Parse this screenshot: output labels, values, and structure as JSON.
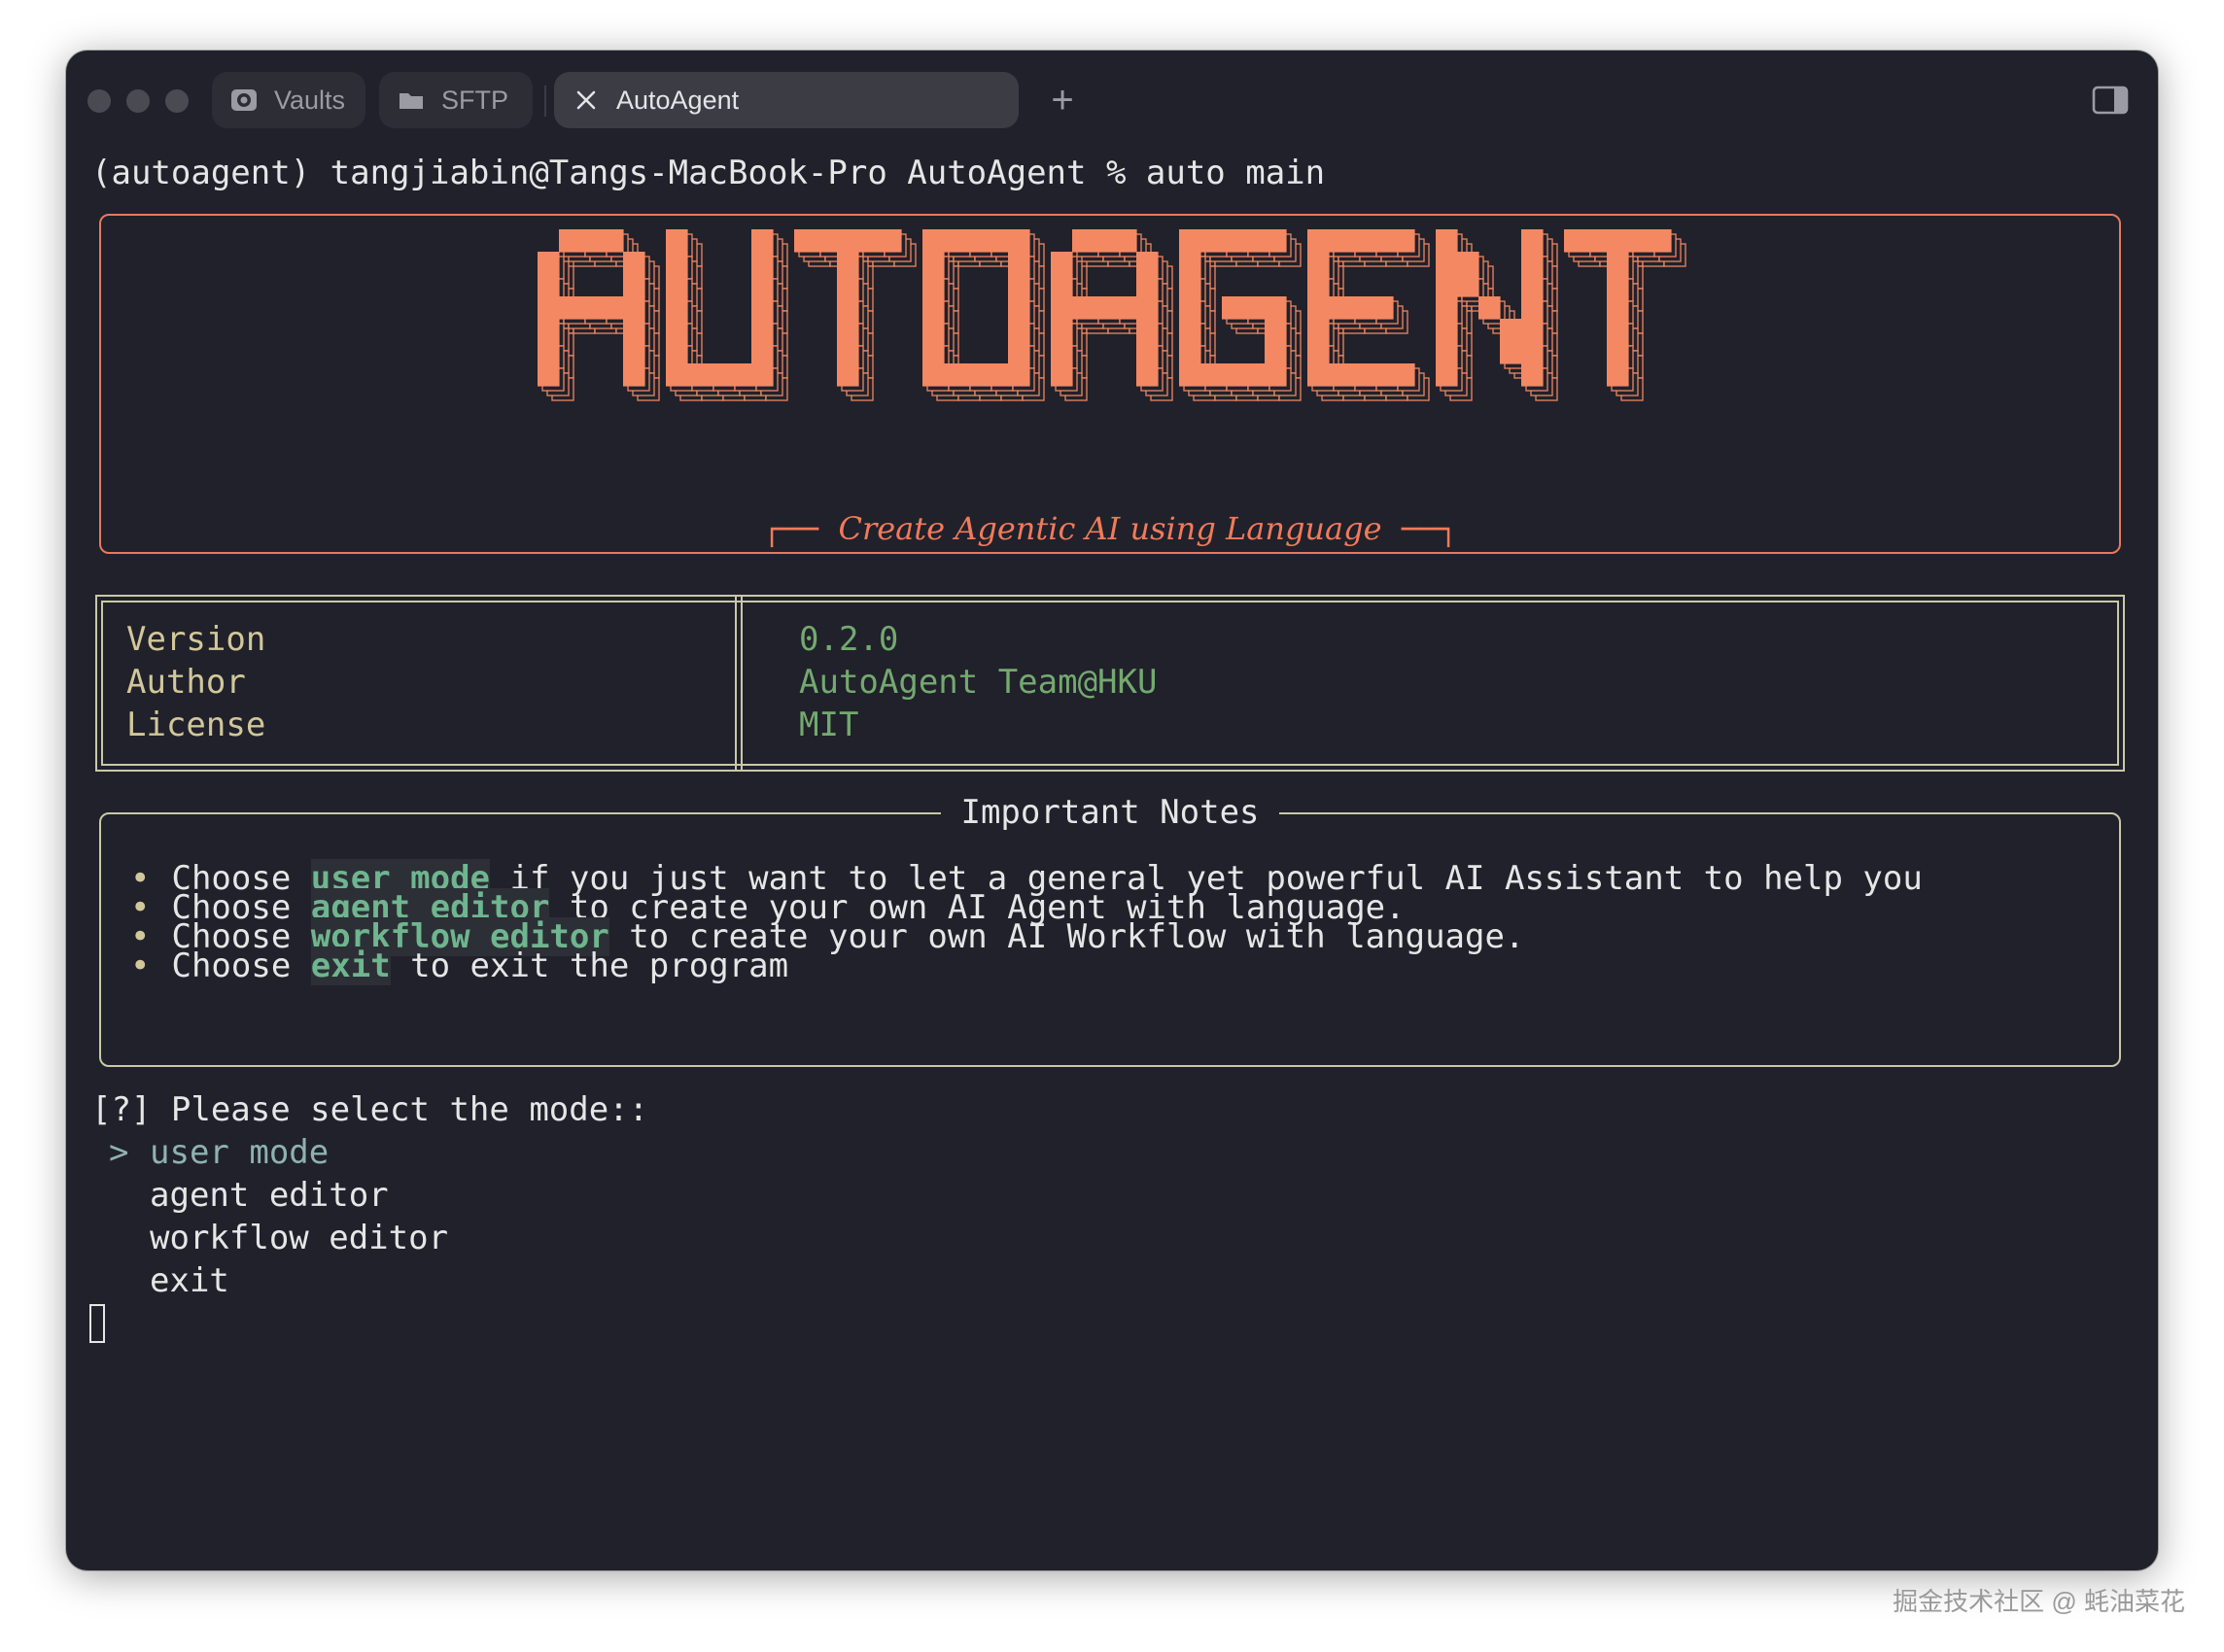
{
  "window": {
    "tabs": [
      {
        "label": "Vaults",
        "icon": "vault-icon"
      },
      {
        "label": "SFTP",
        "icon": "folder-icon"
      },
      {
        "label": "AutoAgent",
        "icon": "close-icon",
        "active": true
      }
    ],
    "new_tab_label": "+"
  },
  "terminal": {
    "command_line": "(autoagent) tangjiabin@Tangs-MacBook-Pro AutoAgent % auto main",
    "banner": {
      "logo_text": "AUTOAGENT",
      "tagline": "Create Agentic AI using Language",
      "color": "#f48862"
    },
    "info": {
      "keys": [
        "Version",
        "Author",
        "License"
      ],
      "values": [
        "0.2.0",
        "AutoAgent Team@HKU",
        "MIT"
      ]
    },
    "notes": {
      "title": "Important Notes",
      "items": [
        {
          "pre": "Choose ",
          "hl": "user mode",
          "post": " if you just want to let a general yet powerful AI Assistant to help you"
        },
        {
          "pre": "Choose ",
          "hl": "agent editor",
          "post": " to create your own AI Agent with language."
        },
        {
          "pre": "Choose ",
          "hl": "workflow editor",
          "post": " to create your own AI Workflow with language."
        },
        {
          "pre": "Choose ",
          "hl": "exit",
          "post": " to exit the program"
        }
      ]
    },
    "prompt": {
      "question": "[?] Please select the mode::",
      "pointer": ">",
      "options": [
        "user mode",
        "agent editor",
        "workflow editor",
        "exit"
      ],
      "selected": "user mode"
    }
  },
  "watermark": "掘金技术社区 @ 蚝油菜花"
}
